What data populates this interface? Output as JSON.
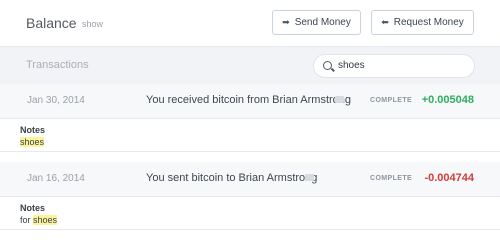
{
  "header": {
    "title": "Balance",
    "show_label": "show",
    "send_money_label": "Send Money",
    "request_money_label": "Request Money"
  },
  "transactions": {
    "title": "Transactions",
    "search": {
      "value": "shoes"
    },
    "items": [
      {
        "date": "Jan 30, 2014",
        "description": "You received bitcoin from Brian Armstrong",
        "status": "COMPLETE",
        "amount": "+0.005048",
        "notes_label": "Notes",
        "notes_prefix": "",
        "notes_highlight": "shoes"
      },
      {
        "date": "Jan 16, 2014",
        "description": "You sent bitcoin to Brian Armstrong",
        "status": "COMPLETE",
        "amount": "-0.004744",
        "notes_label": "Notes",
        "notes_prefix": "for ",
        "notes_highlight": "shoes"
      }
    ]
  },
  "colors": {
    "positive": "#2fae5e",
    "negative": "#d13b3b",
    "highlight": "#fbf49b"
  },
  "icons": {
    "send": "right-arrow-icon",
    "request": "left-arrow-icon",
    "search": "search-icon",
    "note": "note-icon"
  }
}
